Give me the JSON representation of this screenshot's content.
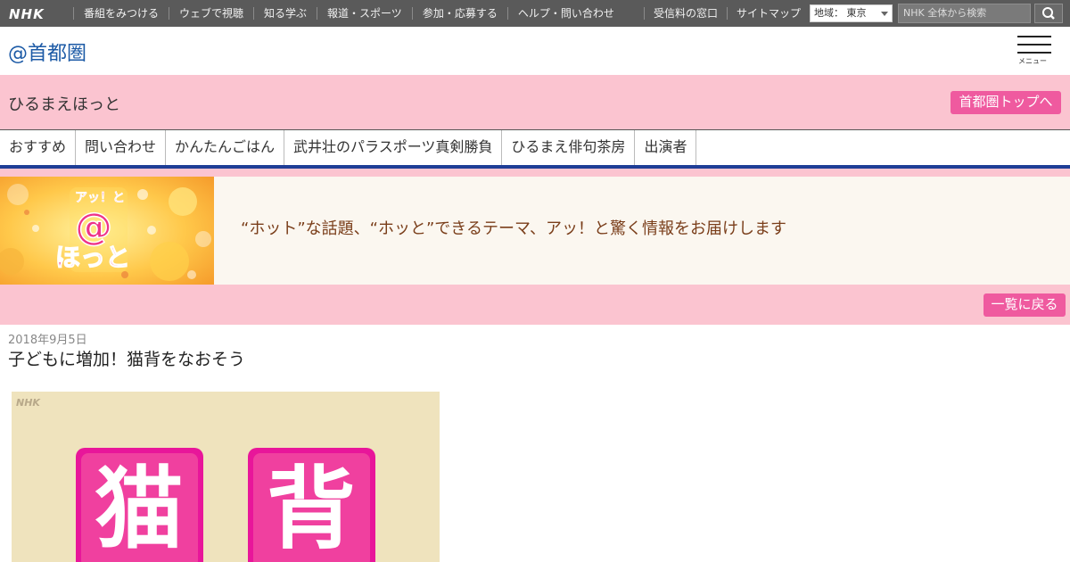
{
  "global_nav": {
    "logo": "NHK",
    "items": [
      "番組をみつける",
      "ウェブで視聴",
      "知る学ぶ",
      "報道・スポーツ",
      "参加・応募する",
      "ヘルプ・問い合わせ"
    ],
    "right_items": [
      "受信料の窓口",
      "サイトマップ"
    ],
    "region": "地域： 東京",
    "search_placeholder": "NHK 全体から検索"
  },
  "site_header": {
    "title": "@首都圏",
    "menu_label": "メニュー"
  },
  "program": {
    "name": "ひるまえほっと",
    "top_button": "首都圏トップへ"
  },
  "tabs": [
    "おすすめ",
    "問い合わせ",
    "かんたんごはん",
    "武井壮のパラスポーツ真剣勝負",
    "ひるまえ俳句茶房",
    "出演者"
  ],
  "banner": {
    "logo_top": "アッ！と",
    "logo_at": "@",
    "logo_bottom": "ほっと",
    "tagline": "“ホット”な話題、“ホッと”できるテーマ、アッ！と驚く情報をお届けします"
  },
  "back_button": "一覧に戻る",
  "article": {
    "date": "2018年9月5日",
    "title": "子どもに増加！猫背をなおそう",
    "image_watermark": "NHK",
    "image_chars": [
      "猫",
      "背"
    ]
  },
  "colors": {
    "global_bar": "#5a5a5a",
    "site_title": "#1c5aa6",
    "pink_band": "#fbc4d0",
    "pink_button": "#ef5a9f",
    "tab_underline": "#1f3e96",
    "tagline": "#7a3e1a"
  }
}
